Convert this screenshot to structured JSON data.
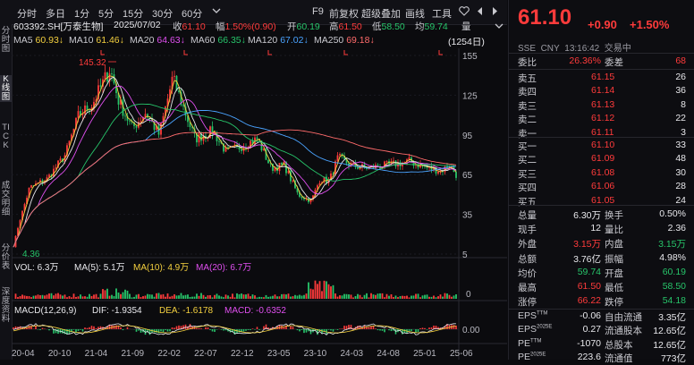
{
  "toolbar": {
    "left_items": [
      "分时",
      "多日",
      "1分",
      "5分",
      "15分",
      "30分",
      "60分"
    ],
    "dropdown_chevron": "chevron-down-icon",
    "right_items": [
      "F9",
      "前复权",
      "超级叠加",
      "画线",
      "工具"
    ],
    "icons": [
      "heart-icon",
      "caret-left-icon",
      "caret-right-icon"
    ]
  },
  "vtabs": [
    "分时图",
    "K线图",
    "TICK",
    "成交明细",
    "分价表",
    "深度资料"
  ],
  "header": {
    "code": "603392.SH[万泰生物]",
    "date": "2025/07/02",
    "close_label": "收",
    "close": "61.10",
    "amp_label": "幅",
    "amp": "1.50%(0.90)",
    "open_label": "开",
    "open": "60.19",
    "high_label": "高",
    "high": "61.50",
    "low_label": "低",
    "low": "58.50",
    "vol_label": "均",
    "vol": "59.74",
    "more": "量"
  },
  "ma_line": [
    {
      "name": "MA5",
      "value": "60.93↓",
      "color": "#f4d03f"
    },
    {
      "name": "MA10",
      "value": "61.46↓",
      "color": "#f4d03f"
    },
    {
      "name": "MA20",
      "value": "64.63↓",
      "color": "#e04ff0"
    },
    {
      "name": "MA60",
      "value": "66.35↓",
      "color": "#27c46a"
    },
    {
      "name": "MA120",
      "value": "67.02↓",
      "color": "#4aa3ff"
    },
    {
      "name": "MA250",
      "value": "69.18↓",
      "color": "#ff6b6b"
    }
  ],
  "bar_count": "(1254日)",
  "main_chart": {
    "y_ticks": [
      "155",
      "125",
      "95",
      "65",
      "35",
      "5"
    ],
    "high_mark": "145.32",
    "low_mark": "4.36"
  },
  "vol_panel": {
    "label": "VOL: 6.3万",
    "ma5": "MA(5): 5.1万",
    "ma10": "MA(10): 4.9万",
    "ma20": "MA(20): 6.7万",
    "y_tick": "0"
  },
  "macd_panel": {
    "label": "MACD(12,26,9)",
    "dif": "DIF: -1.9354",
    "dea": "DEA: -1.6178",
    "macd": "MACD: -0.6352",
    "y_tick": "0.00"
  },
  "x_ticks": [
    "20-04",
    "20-10",
    "21-04",
    "21-09",
    "22-02",
    "22-07",
    "22-12",
    "23-05",
    "23-10",
    "24-03",
    "24-08",
    "25-01",
    "25-06"
  ],
  "quote": {
    "price": "61.10",
    "change": "+0.90",
    "pct": "+1.50%",
    "exchange": "SSE",
    "currency": "CNY",
    "time": "13:16:42",
    "status": "交易中",
    "weibi_label": "委比",
    "weibi": "26.36%",
    "weicha_label": "委差",
    "weicha": "68",
    "asks": [
      {
        "label": "卖五",
        "price": "61.15",
        "vol": "26"
      },
      {
        "label": "卖四",
        "price": "61.14",
        "vol": "36"
      },
      {
        "label": "卖三",
        "price": "61.13",
        "vol": "8"
      },
      {
        "label": "卖二",
        "price": "61.12",
        "vol": "22"
      },
      {
        "label": "卖一",
        "price": "61.11",
        "vol": "3"
      }
    ],
    "bids": [
      {
        "label": "买一",
        "price": "61.10",
        "vol": "33"
      },
      {
        "label": "买二",
        "price": "61.09",
        "vol": "48"
      },
      {
        "label": "买三",
        "price": "61.08",
        "vol": "30"
      },
      {
        "label": "买四",
        "price": "61.06",
        "vol": "28"
      },
      {
        "label": "买五",
        "price": "61.05",
        "vol": "24"
      }
    ],
    "stats": [
      {
        "l1": "总量",
        "v1": "6.30万",
        "c1": "#e8e8ec",
        "l2": "换手",
        "v2": "0.50%",
        "c2": "#e8e8ec"
      },
      {
        "l1": "现手",
        "v1": "12",
        "c1": "#e8e8ec",
        "l2": "量比",
        "v2": "2.36",
        "c2": "#e8e8ec"
      },
      {
        "l1": "外盘",
        "v1": "3.15万",
        "c1": "#ff3b3b",
        "l2": "内盘",
        "v2": "3.15万",
        "c2": "#27c46a"
      },
      {
        "l1": "总额",
        "v1": "3.76亿",
        "c1": "#e8e8ec",
        "l2": "振幅",
        "v2": "4.98%",
        "c2": "#e8e8ec"
      },
      {
        "l1": "均价",
        "v1": "59.74",
        "c1": "#27c46a",
        "l2": "开盘",
        "v2": "60.19",
        "c2": "#27c46a"
      },
      {
        "l1": "最高",
        "v1": "61.50",
        "c1": "#ff3b3b",
        "l2": "最低",
        "v2": "58.50",
        "c2": "#27c46a"
      },
      {
        "l1": "涨停",
        "v1": "66.22",
        "c1": "#ff3b3b",
        "l2": "跌停",
        "v2": "54.18",
        "c2": "#27c46a"
      }
    ],
    "fin": [
      {
        "l1": "EPS",
        "sup1": "TTM",
        "v1": "-0.06",
        "l2": "自由流通",
        "v2": "3.35亿"
      },
      {
        "l1": "EPS",
        "sup1": "2025E",
        "v1": "0.27",
        "l2": "流通股本",
        "v2": "12.65亿"
      },
      {
        "l1": "PE",
        "sup1": "TTM",
        "v1": "-1070",
        "l2": "总股本",
        "v2": "12.65亿"
      },
      {
        "l1": "PE",
        "sup1": "2025E",
        "v1": "223.6",
        "l2": "流通值",
        "v2": "773亿"
      }
    ]
  }
}
